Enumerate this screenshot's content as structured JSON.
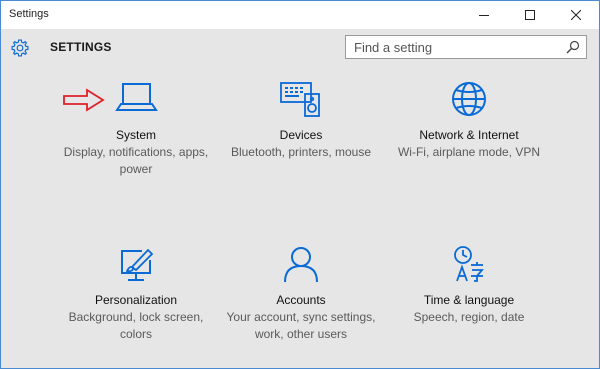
{
  "window": {
    "title": "Settings"
  },
  "header": {
    "title": "SETTINGS",
    "search_placeholder": "Find a setting"
  },
  "tiles": [
    {
      "title": "System",
      "desc": "Display, notifications, apps, power",
      "icon": "laptop-icon"
    },
    {
      "title": "Devices",
      "desc": "Bluetooth, printers, mouse",
      "icon": "devices-icon"
    },
    {
      "title": "Network & Internet",
      "desc": "Wi-Fi, airplane mode, VPN",
      "icon": "globe-icon"
    },
    {
      "title": "Personalization",
      "desc": "Background, lock screen, colors",
      "icon": "paint-icon"
    },
    {
      "title": "Accounts",
      "desc": "Your account, sync settings, work, other users",
      "icon": "person-icon"
    },
    {
      "title": "Time & language",
      "desc": "Speech, region, date",
      "icon": "time-language-icon"
    }
  ],
  "colors": {
    "accent": "#0a6ad6",
    "arrow": "#e0202a",
    "background": "#e6e6e6"
  }
}
